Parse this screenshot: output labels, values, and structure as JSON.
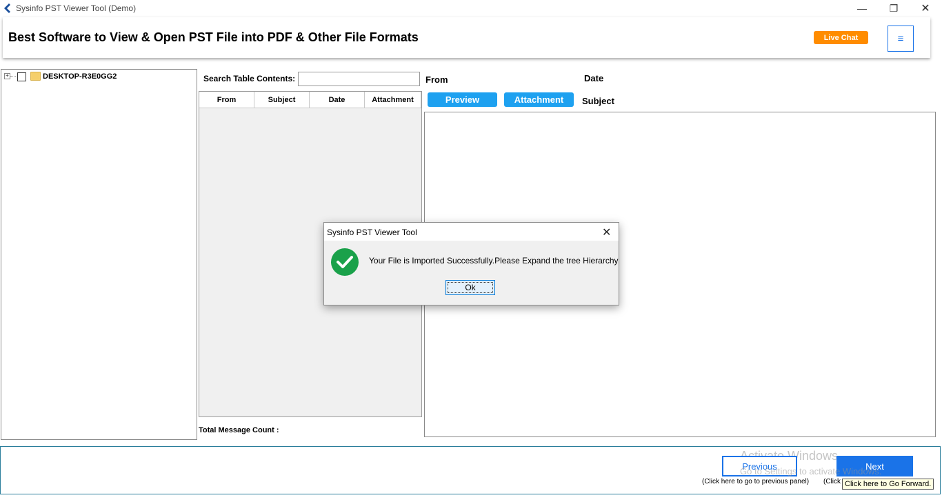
{
  "window": {
    "title": "Sysinfo PST Viewer Tool (Demo)",
    "minimize": "—",
    "maximize": "❐",
    "close": "✕"
  },
  "header": {
    "title": "Best Software to View & Open PST File into PDF & Other File Formats",
    "live_chat": "Live Chat",
    "menu_icon": "≡"
  },
  "tree": {
    "expander": "+",
    "root_label": "DESKTOP-R3E0GG2"
  },
  "search": {
    "label": "Search Table Contents:",
    "value": ""
  },
  "grid": {
    "columns": [
      "From",
      "Subject",
      "Date",
      "Attachment"
    ]
  },
  "total_message_count": "Total Message Count :",
  "preview": {
    "from_label": "From",
    "date_label": "Date",
    "subject_label": "Subject",
    "preview_button": "Preview",
    "attachment_button": "Attachment"
  },
  "footer": {
    "previous": "Previous",
    "next": "Next",
    "previous_hint": "(Click here to go to previous panel)",
    "next_hint": "(Click",
    "tooltip": "Click here to Go Forward.",
    "watermark_line1": "Activate Windows",
    "watermark_line2": "Go to Settings to activate Windows."
  },
  "dialog": {
    "title": "Sysinfo PST Viewer Tool",
    "close": "✕",
    "message": "Your File is Imported Successfully.Please Expand the tree Hierarchy",
    "ok": "Ok"
  },
  "colors": {
    "accent_blue": "#1a73e8",
    "button_blue": "#1ea1f0",
    "live_chat_orange": "#ff8c00",
    "success_green": "#1aa14a",
    "footer_border": "#2a7d9b"
  }
}
